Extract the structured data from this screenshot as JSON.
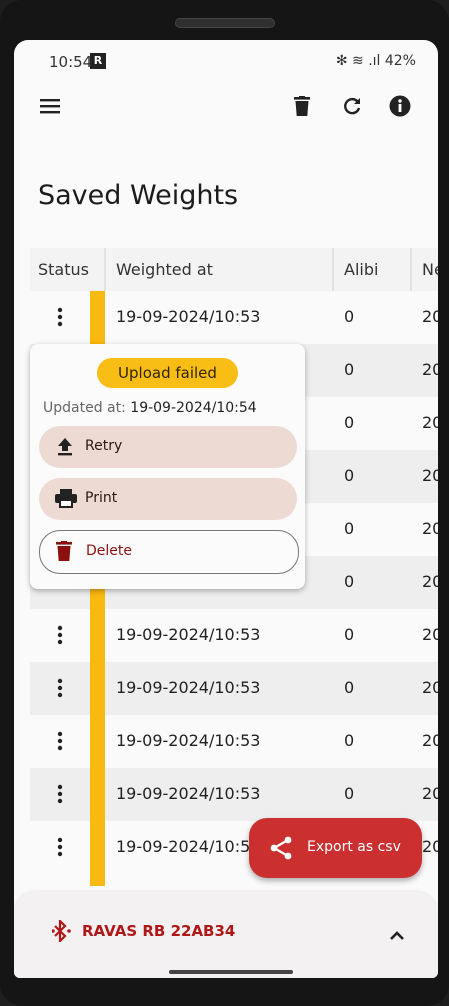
{
  "status_bar": {
    "time": "10:54",
    "app_badge": "R",
    "right": "✻ ≋ .ıl 42%"
  },
  "page": {
    "title": "Saved Weights"
  },
  "table": {
    "headers": [
      "Status",
      "Weighted at",
      "Alibi",
      "Ne"
    ],
    "rows": [
      {
        "weighted_at": "19-09-2024/10:53",
        "alibi": "0",
        "net": "20"
      },
      {
        "weighted_at": "",
        "alibi": "0",
        "net": "20"
      },
      {
        "weighted_at": "",
        "alibi": "0",
        "net": "20"
      },
      {
        "weighted_at": "",
        "alibi": "0",
        "net": "20"
      },
      {
        "weighted_at": "",
        "alibi": "0",
        "net": "20"
      },
      {
        "weighted_at": "",
        "alibi": "0",
        "net": "20"
      },
      {
        "weighted_at": "19-09-2024/10:53",
        "alibi": "0",
        "net": "20"
      },
      {
        "weighted_at": "19-09-2024/10:53",
        "alibi": "0",
        "net": "20"
      },
      {
        "weighted_at": "19-09-2024/10:53",
        "alibi": "0",
        "net": "20"
      },
      {
        "weighted_at": "19-09-2024/10:53",
        "alibi": "0",
        "net": "20"
      },
      {
        "weighted_at": "19-09-2024/10:5",
        "alibi": "",
        "net": "20"
      }
    ]
  },
  "popup": {
    "badge": "Upload failed",
    "updated_label": "Updated at:",
    "updated_value": "19-09-2024/10:54",
    "retry_label": "Retry",
    "print_label": "Print",
    "delete_label": "Delete"
  },
  "fab": {
    "label": "Export as csv"
  },
  "device": {
    "name": "RAVAS RB 22AB34"
  },
  "colors": {
    "accent_red": "#cc2f2f",
    "status_yellow": "#f9b90e",
    "action_bg": "#ecdad3"
  }
}
